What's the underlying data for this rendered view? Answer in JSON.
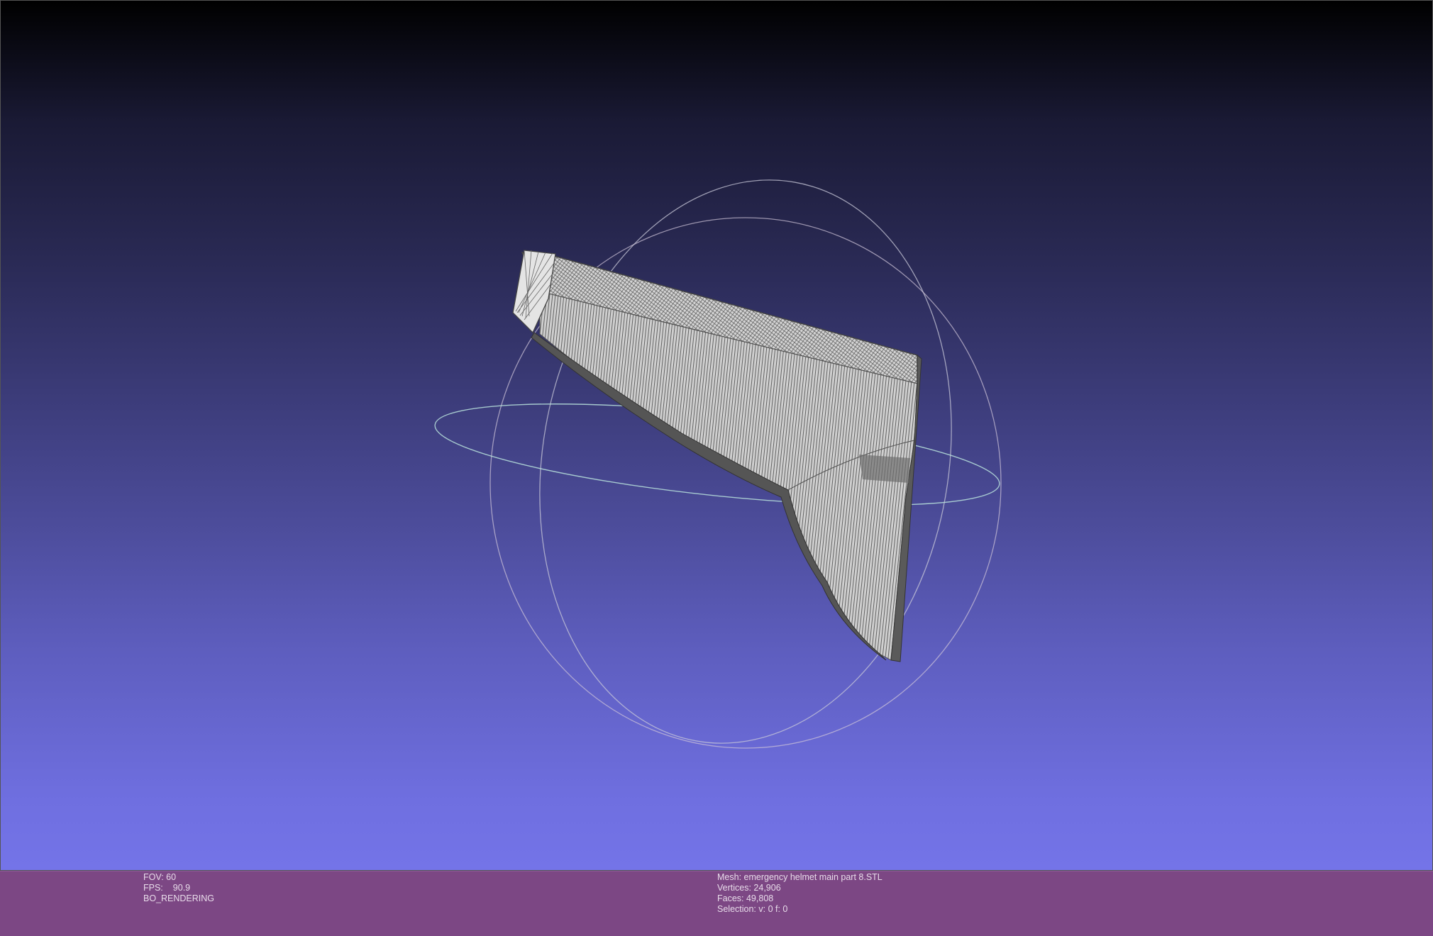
{
  "viewer": {
    "left_info": {
      "fov": "FOV: 60",
      "fps_label": "FPS:",
      "fps_value": "90.9",
      "render_mode": "BO_RENDERING"
    },
    "right_info": {
      "mesh": "Mesh: emergency helmet main part 8.STL",
      "vertices": "Vertices: 24,906",
      "faces": "Faces: 49,808",
      "selection": "Selection: v: 0 f: 0"
    }
  },
  "colors": {
    "status_bar": "#7c4784",
    "background_top": "#000000",
    "background_bottom": "#7474e8",
    "mesh_fill": "#d8d8d8",
    "mesh_wire": "#4a4a4a",
    "trackball": "#c8c8d8"
  }
}
